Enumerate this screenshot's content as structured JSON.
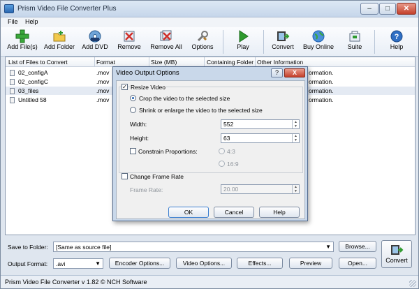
{
  "window": {
    "title": "Prism Video File Converter Plus"
  },
  "menu": {
    "file": "File",
    "help": "Help"
  },
  "toolbar": {
    "add_files": "Add File(s)",
    "add_folder": "Add Folder",
    "add_dvd": "Add DVD",
    "remove": "Remove",
    "remove_all": "Remove All",
    "options": "Options",
    "play": "Play",
    "convert": "Convert",
    "buy_online": "Buy Online",
    "suite": "Suite",
    "help": "Help"
  },
  "list": {
    "columns": [
      "List of Files to Convert",
      "Format",
      "Size (MB)",
      "Containing Folder",
      "Other Information"
    ],
    "rows": [
      {
        "name": "02_configA",
        "format": ".mov",
        "info": "ormation."
      },
      {
        "name": "02_configC",
        "format": ".mov",
        "info": "ormation."
      },
      {
        "name": "03_files",
        "format": ".mov",
        "info": "ormation."
      },
      {
        "name": "Untitled 58",
        "format": ".mov",
        "info": "ormation."
      }
    ]
  },
  "dialog": {
    "title": "Video Output Options",
    "help_btn": "?",
    "close_btn": "X",
    "resize_label": "Resize Video",
    "crop_label": "Crop the video to the selected size",
    "shrink_label": "Shrink or enlarge the video to the selected size",
    "width_label": "Width:",
    "width_value": "552",
    "height_label": "Height:",
    "height_value": "63",
    "constrain_label": "Constrain Proportions:",
    "ratio_43": "4:3",
    "ratio_169": "16:9",
    "frame_rate_check": "Change Frame Rate",
    "frame_rate_label": "Frame Rate:",
    "frame_rate_value": "20.00",
    "ok": "OK",
    "cancel": "Cancel",
    "help": "Help"
  },
  "bottom": {
    "save_label": "Save to Folder:",
    "save_value": "[Same as source file]",
    "browse": "Browse...",
    "format_label": "Output Format:",
    "format_value": ".avi",
    "encoder_options": "Encoder Options...",
    "video_options": "Video Options...",
    "effects": "Effects...",
    "preview": "Preview",
    "open": "Open...",
    "convert": "Convert"
  },
  "status": {
    "text": "Prism Video File Converter v 1.82 © NCH Software"
  },
  "colors": {
    "accent": "#1f5fb0",
    "close_red": "#c4402b",
    "green": "#2e9a2e"
  }
}
